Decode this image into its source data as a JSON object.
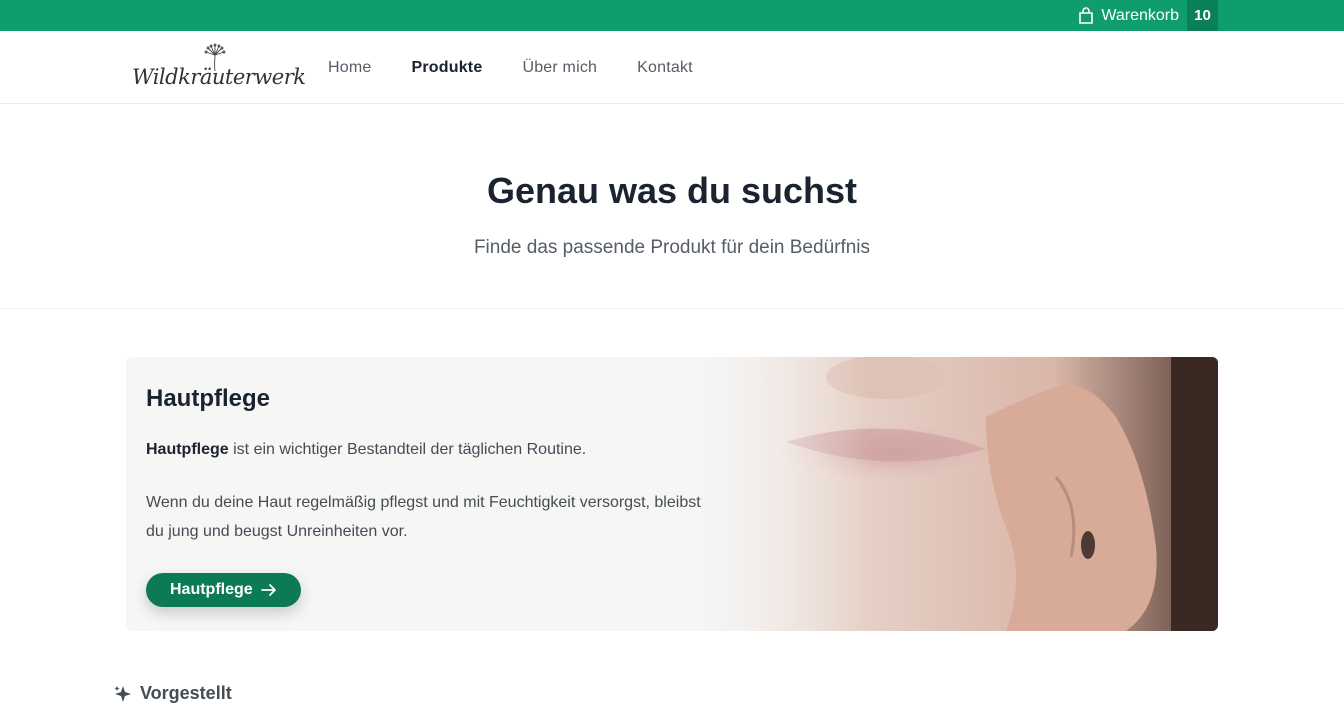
{
  "topbar": {
    "cart_label": "Warenkorb",
    "cart_count": "10",
    "cart_icon": "shopping-bag-icon",
    "color": "#0f9d6b"
  },
  "navbar": {
    "logo_text": "Wildkräuterwerk",
    "links": [
      {
        "label": "Home",
        "active": false
      },
      {
        "label": "Produkte",
        "active": true
      },
      {
        "label": "Über mich",
        "active": false
      },
      {
        "label": "Kontakt",
        "active": false
      }
    ]
  },
  "hero": {
    "title": "Genau was du suchst",
    "subtitle": "Finde das passende Produkt für dein Bedürfnis"
  },
  "category_card": {
    "title": "Hautpflege",
    "intro_bold": "Hautpflege",
    "intro_rest": " ist ein wichtiger Bestandteil der täglichen Routine.",
    "body": "Wenn du deine Haut regelmäßig pflegst und mit Feuchtigkeit versorgst, bleibst du jung und beugst Unreinheiten vor.",
    "button_label": "Hautpflege",
    "button_icon": "arrow-right-icon",
    "button_color": "#0b7a55"
  },
  "featured": {
    "label": "Vorgestellt",
    "icon": "sparkle-icon"
  }
}
